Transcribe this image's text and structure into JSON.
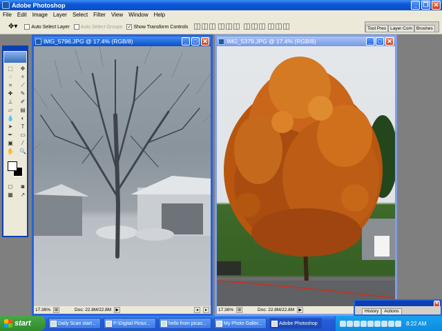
{
  "app": {
    "title": "Adobe Photoshop"
  },
  "menu": [
    "File",
    "Edit",
    "Image",
    "Layer",
    "Select",
    "Filter",
    "View",
    "Window",
    "Help"
  ],
  "options_bar": {
    "auto_select_layer": "Auto Select Layer",
    "auto_select_groups": "Auto Select Groups",
    "show_transform_controls": "Show Transform Controls",
    "palette_tabs": [
      "Tool Pres",
      "Layer Com",
      "Brushes"
    ]
  },
  "documents": [
    {
      "title": "IMG_5796.JPG @ 17.4% (RGB/8)",
      "zoom": "17.36%",
      "doc_size": "Doc: 22.8M/22.8M",
      "active": true
    },
    {
      "title": "IMG_5379.JPG @ 17.4% (RGB/8)",
      "zoom": "17.36%",
      "doc_size": "Doc: 22.8M/22.8M",
      "active": false
    }
  ],
  "history_palette": {
    "tabs": [
      "History",
      "Actions"
    ]
  },
  "taskbar": {
    "start_label": "start",
    "tasks": [
      "Daily Scan start...",
      "P:\\Digital Pictur...",
      "hello from picas...",
      "My Photo Galler...",
      "Adobe Photoshop"
    ],
    "clock": "8:22 AM"
  },
  "colors": {
    "title_blue": "#0b4fc8",
    "taskbar_blue": "#245edb",
    "start_green": "#2f8a2f",
    "foreground": "#ffffff",
    "background": "#000000"
  }
}
